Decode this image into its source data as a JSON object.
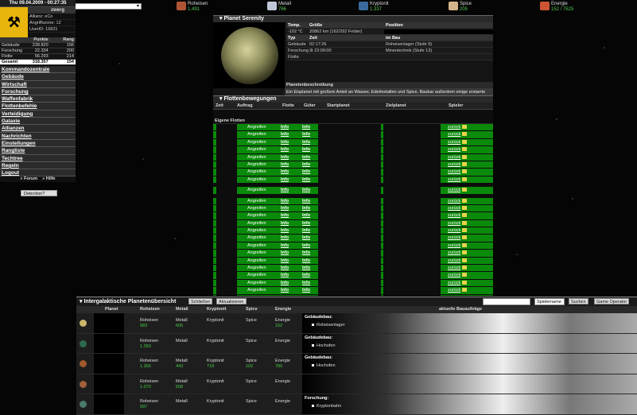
{
  "topbar": {
    "select_value": "",
    "resources": [
      {
        "name": "Roheisen",
        "value": "1.491",
        "color": "#b05533"
      },
      {
        "name": "Metall",
        "value": "766",
        "color": "#c0c8d8"
      },
      {
        "name": "Kryptonit",
        "value": "1.337",
        "color": "#3a6a9a"
      },
      {
        "name": "Spice",
        "value": "205",
        "color": "#d4b48c"
      },
      {
        "name": "Energie",
        "value": "152 / 7625",
        "color": "#cc5533"
      }
    ]
  },
  "sidebar": {
    "datetime": "Thu 09.04.2009 - 00:27:35",
    "username": "zwerg",
    "allianz": "Allianz: eCo",
    "angriffszone": "Angriffszone: 12",
    "userid": "UserID: 16821",
    "stats_header": [
      "",
      "Punkte",
      "Rang"
    ],
    "stats": [
      [
        "Gebäude",
        "239.820",
        "156"
      ],
      [
        "Forschung",
        "22.334",
        "200"
      ],
      [
        "Flotte",
        "56.293",
        "214"
      ],
      [
        "Gesamt",
        "318.357",
        "154"
      ]
    ],
    "menu": [
      "Kommandozentrale",
      "Gebäude",
      "Wirtschaft",
      "Forschung",
      "Waffenfabrik",
      "Flottenbefehle",
      "Verteidigung",
      "Galaxie",
      "Allianzen",
      "Nachrichten",
      "Einstellungen",
      "Rangliste",
      "Techtree",
      "Regeln",
      "Logout"
    ],
    "forum": "Forum",
    "hilfe": "Hilfe",
    "detection": "Detection?"
  },
  "planet": {
    "title": "Planet Serenity",
    "col_temp": "Temp.",
    "col_groesse": "Größe",
    "col_position": "Position",
    "temp": "-102 °C",
    "groesse": "20862 km (162/292 Felder)",
    "position": "",
    "col_typ": "Typ",
    "col_zeit": "Zeit",
    "col_imbau": "im Bau",
    "row_gebaeude": "Gebäude",
    "zeit_gebaeude": "02:17:26",
    "bau_gebaeude": "Roheisenlager (Stufe 9)",
    "row_forschung": "Forschung",
    "zeit_forschung": "3t 23:09:00",
    "bau_forschung": "Minentechnik (Stufe 13)",
    "row_flotte": "Flotte",
    "zeit_flotte": "",
    "bau_flotte": "",
    "desc_header": "Planetenbeschreibung",
    "description": "Ein Eisplanet mit großem Anteil an Wasser, Edelmetallen und Spice. Baubar außerdem einige erstarrte Vulkane längst vergangener Zeit."
  },
  "fleet": {
    "title": "Flottenbewegungen",
    "columns": [
      "Zeit",
      "Auftrag",
      "Flotte",
      "Güter",
      "Startplanet",
      "Zielplanet",
      "Spieler"
    ],
    "own_header": "Eigene Flotten",
    "action": "Angreifen",
    "info1": "Info",
    "info2": "Info",
    "zurueck": "zurück"
  },
  "overview": {
    "title": "Intergalaktische Planetenübersicht",
    "btn_close": "Schließen",
    "btn_refresh": "Aktualisieren",
    "search_value": "",
    "search_select": "Spielername",
    "btn_search": "Suchen",
    "btn_operator": "Game Operator",
    "columns": [
      "Planet",
      "Roheisen",
      "Metall",
      "Kryptonit",
      "Spice",
      "Energie",
      "aktuelle Bauaufträge"
    ],
    "rows": [
      {
        "color": "#c9b66a",
        "roh": "983",
        "met": "605",
        "kry": "",
        "spi": "",
        "ene": "152",
        "bau_title": "Gebäudebau:",
        "bau_item": "Roheisenlager"
      },
      {
        "color": "#2d6a4a",
        "roh": "1.359",
        "met": "",
        "kry": "",
        "spi": "",
        "ene": "",
        "bau_title": "Gebäudebau:",
        "bau_item": "Hochofen"
      },
      {
        "color": "#a05a2a",
        "roh": "1.366",
        "met": "443",
        "kry": "718",
        "spi": "102",
        "ene": "780",
        "bau_title": "Gebäudebau:",
        "bau_item": "Hochofen"
      },
      {
        "color": "#a0603a",
        "roh": "1.070",
        "met": "608",
        "kry": "",
        "spi": "",
        "ene": "",
        "bau_title": "",
        "bau_item": ""
      },
      {
        "color": "#4a7a6a",
        "roh": "997",
        "met": "",
        "kry": "",
        "spi": "",
        "ene": "",
        "bau_title": "Forschung:",
        "bau_item": "Kryptonbahn"
      }
    ]
  }
}
